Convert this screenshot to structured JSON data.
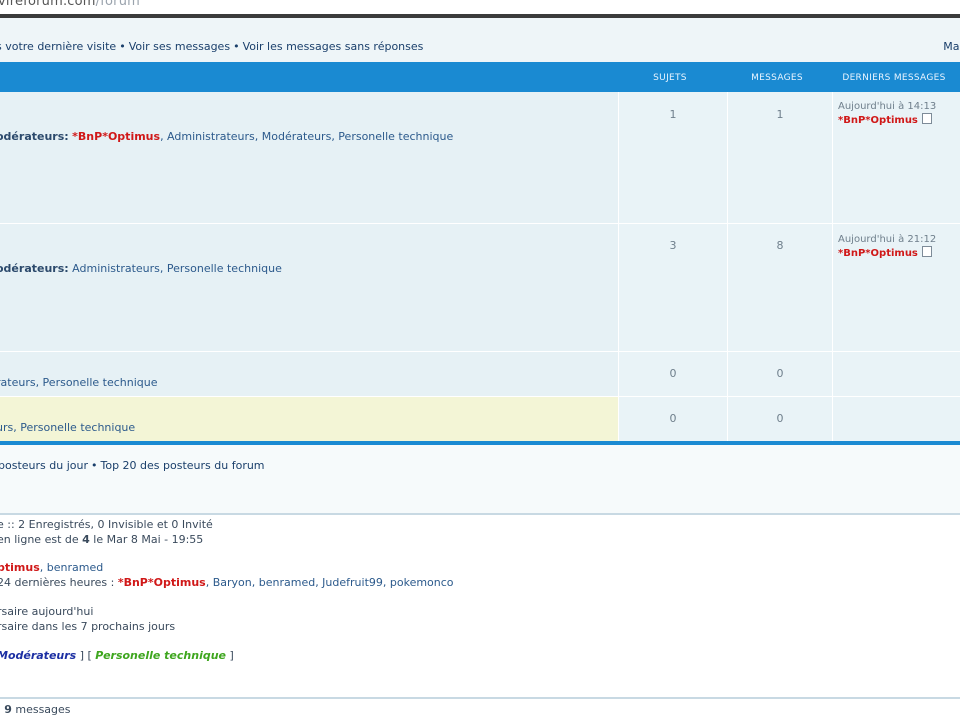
{
  "site": {
    "url_main": "vireforum.com",
    "url_path": "/forum"
  },
  "nav": {
    "links": [
      "s votre dernière visite",
      "Voir ses messages",
      "Voir les messages sans réponses"
    ],
    "right": "Mar"
  },
  "table": {
    "headers": {
      "sujets": "SUJETS",
      "messages": "MESSAGES",
      "derniers": "DERNIERS MESSAGES"
    },
    "rows": [
      {
        "mod_label": "odérateurs:",
        "mod_optimus": "*BnP*Optimus",
        "mod_rest": ", Administrateurs, Modérateurs, Personelle technique",
        "sujets": "1",
        "messages": "1",
        "last_time": "Aujourd'hui à 14:13",
        "last_user": "*BnP*Optimus"
      },
      {
        "mod_label": "odérateurs:",
        "mod_rest": " Administrateurs, Personelle technique",
        "sujets": "3",
        "messages": "8",
        "last_time": "Aujourd'hui à 21:12",
        "last_user": "*BnP*Optimus"
      },
      {
        "mod_rest": "rateurs, Personelle technique",
        "sujets": "0",
        "messages": "0"
      },
      {
        "mod_rest": "urs, Personelle technique",
        "sujets": "0",
        "messages": "0"
      }
    ]
  },
  "stats": {
    "top_links": [
      "posteurs du jour",
      "Top 20 des posteurs du forum"
    ]
  },
  "who": {
    "line1": "e :: 2 Enregistrés, 0 Invisible et 0 Invité",
    "line2_a": "en ligne est de ",
    "line2_b": "4",
    "line2_c": " le Mar 8 Mai - 19:55",
    "line3_red": "ptimus",
    "line3_rest": ", benramed",
    "line4_a": "24 dernières heures : ",
    "line4_red": "*BnP*Optimus",
    "line4_rest": ", Baryon, benramed, Judefruit99, pokemonco",
    "line5": "rsaire aujourd'hui",
    "line6": "rsaire dans les 7 prochains jours",
    "legend_admin": "Modérateurs",
    "legend_mid": " ] [ ",
    "legend_tech": "Personelle technique",
    "legend_end": " ]"
  },
  "footer": {
    "pre": ": ",
    "count": "9",
    "post": " messages"
  },
  "colors": {
    "header": "#1a8ad2",
    "row_a": "#e6f1f5",
    "row_b": "#eef5f8",
    "row_highlight": "#f3f5d6",
    "optimus": "#d01818"
  }
}
